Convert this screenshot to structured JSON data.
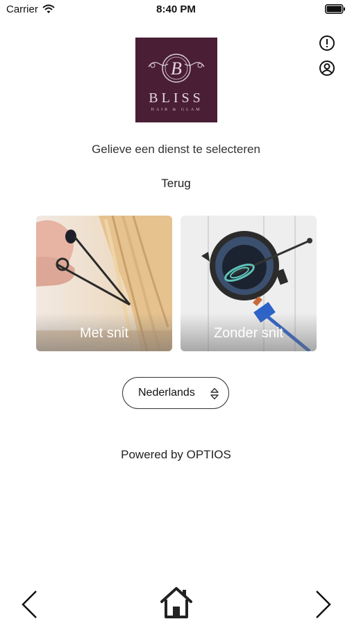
{
  "status_bar": {
    "carrier": "Carrier",
    "time": "8:40 PM"
  },
  "header": {
    "logo": {
      "initial": "B",
      "name": "BLISS",
      "tagline": "HAIR & GLAM"
    },
    "icons": [
      "info-icon",
      "account-icon"
    ]
  },
  "main": {
    "prompt": "Gelieve een dienst te selecteren",
    "back_label": "Terug",
    "services": [
      {
        "label": "Met snit",
        "image": "scissors-cutting-blonde-hair"
      },
      {
        "label": "Zonder snit",
        "image": "color-bowl-whisk-brush"
      }
    ],
    "language": {
      "selected": "Nederlands"
    },
    "powered_by": "Powered by OPTIOS"
  },
  "bottom_nav": {
    "icons": [
      "chevron-left-icon",
      "home-icon",
      "chevron-right-icon"
    ]
  },
  "colors": {
    "logo_background": "#4a1e34",
    "text": "#222222",
    "background": "#ffffff"
  }
}
